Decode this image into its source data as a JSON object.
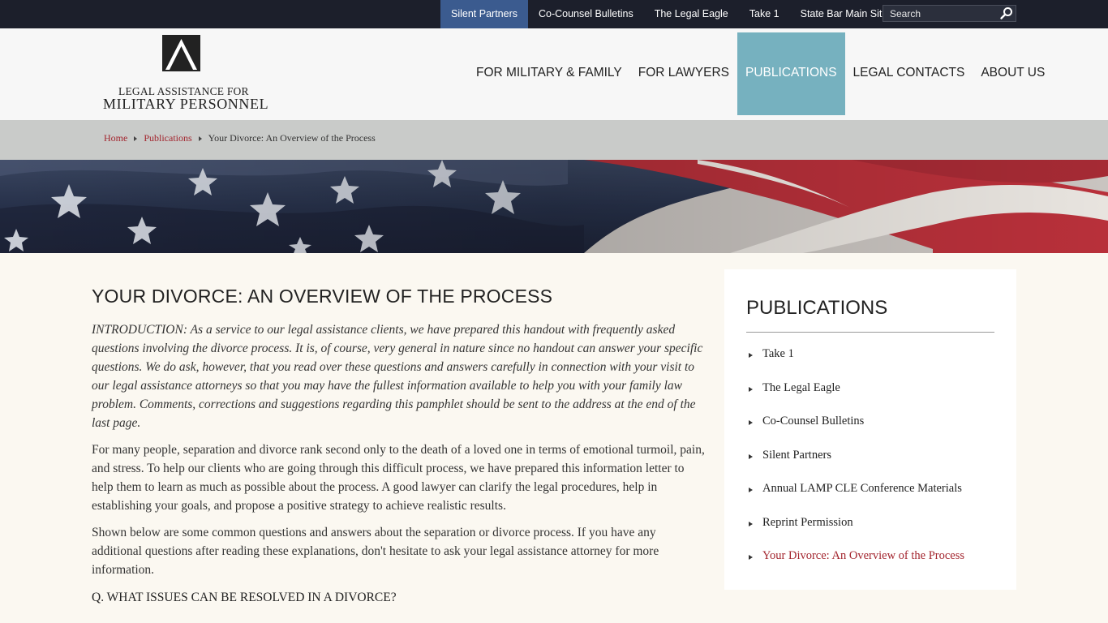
{
  "topbar": {
    "links": [
      {
        "label": "Silent Partners",
        "active": true
      },
      {
        "label": "Co-Counsel Bulletins",
        "active": false
      },
      {
        "label": "The Legal Eagle",
        "active": false
      },
      {
        "label": "Take 1",
        "active": false
      },
      {
        "label": "State Bar Main Site",
        "active": false
      }
    ],
    "search_placeholder": "Search"
  },
  "logo": {
    "line1": "LEGAL ASSISTANCE FOR",
    "line2": "MILITARY PERSONNEL"
  },
  "mainnav": [
    {
      "label": "FOR MILITARY & FAMILY"
    },
    {
      "label": "FOR LAWYERS"
    },
    {
      "label": "PUBLICATIONS",
      "active": true
    },
    {
      "label": "LEGAL CONTACTS"
    },
    {
      "label": "ABOUT US"
    }
  ],
  "breadcrumb": {
    "home": "Home",
    "section": "Publications",
    "current": "Your Divorce: An Overview of the Process"
  },
  "article": {
    "title": "YOUR DIVORCE: AN OVERVIEW OF THE PROCESS",
    "intro": "INTRODUCTION: As a service to our legal assistance clients, we have prepared this handout with frequently asked questions involving the divorce process. It is, of course, very general in nature since no handout can answer your specific questions. We do ask, however, that you read over these questions and answers carefully in connection with your visit to our legal assistance attorneys so that you may have the fullest information available to help you with your family law problem. Comments, corrections and suggestions regarding this pamphlet should be sent to the address at the end of the last page.",
    "para1": "For many people, separation and divorce rank second only to the death of a loved one in terms of emotional turmoil, pain, and stress. To help our clients who are going through this difficult process, we have prepared this information letter to help them to learn as much as possible about the process. A good lawyer can clarify the legal procedures, help in establishing your goals, and propose a positive strategy to achieve realistic results.",
    "para2": "Shown below are some common questions and answers about the separation or divorce process. If you have any additional questions after reading these explanations, don't hesitate to ask your legal assistance attorney for more information.",
    "question1": "Q. WHAT ISSUES CAN BE RESOLVED IN A DIVORCE?"
  },
  "sidebar": {
    "title": "PUBLICATIONS",
    "items": [
      {
        "label": "Take 1"
      },
      {
        "label": "The Legal Eagle"
      },
      {
        "label": "Co-Counsel Bulletins"
      },
      {
        "label": "Silent Partners"
      },
      {
        "label": "Annual LAMP CLE Conference Materials"
      },
      {
        "label": "Reprint Permission"
      },
      {
        "label": "Your Divorce: An Overview of the Process",
        "current": true
      }
    ]
  },
  "colors": {
    "topbar_bg": "#1c1f2b",
    "active_top": "#3b5b8f",
    "nav_active": "#76b1bf",
    "link_red": "#a3252e"
  }
}
